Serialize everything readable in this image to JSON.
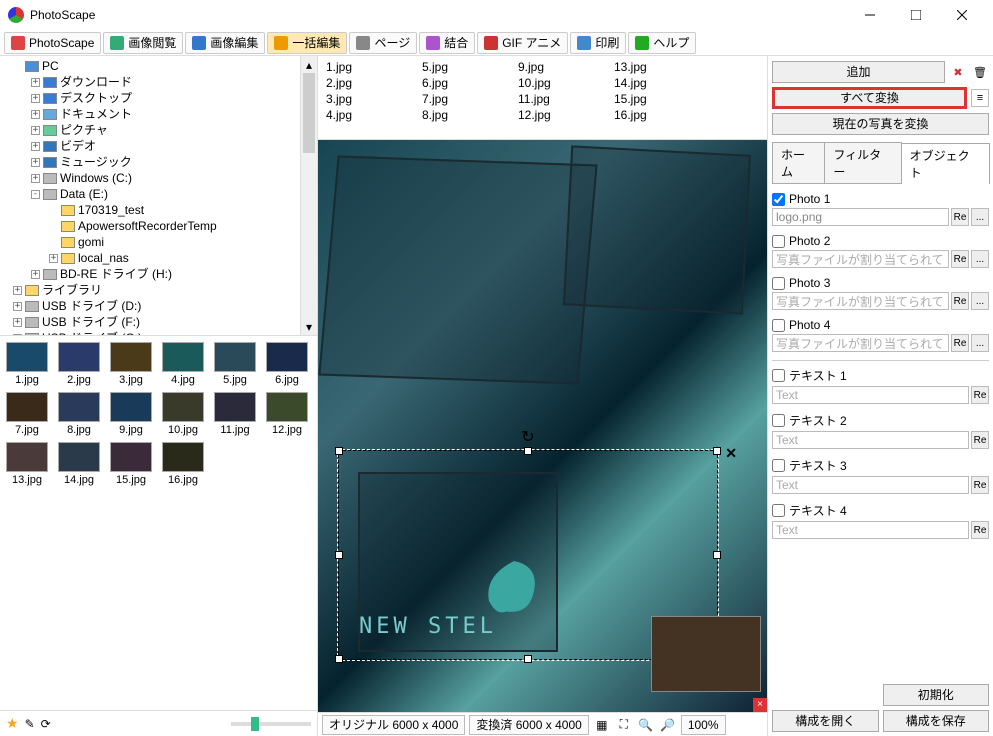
{
  "title": "PhotoScape",
  "toolbar": [
    {
      "label": "PhotoScape",
      "icon": "app"
    },
    {
      "label": "画像閲覧",
      "icon": "view"
    },
    {
      "label": "画像編集",
      "icon": "edit"
    },
    {
      "label": "一括編集",
      "icon": "batch",
      "active": true
    },
    {
      "label": "ページ",
      "icon": "page"
    },
    {
      "label": "結合",
      "icon": "combine"
    },
    {
      "label": "GIF アニメ",
      "icon": "gif"
    },
    {
      "label": "印刷",
      "icon": "print"
    },
    {
      "label": "ヘルプ",
      "icon": "help"
    }
  ],
  "tree": [
    {
      "depth": 0,
      "exp": "",
      "icon": "pc",
      "label": "PC"
    },
    {
      "depth": 1,
      "exp": "+",
      "icon": "dl",
      "label": "ダウンロード"
    },
    {
      "depth": 1,
      "exp": "+",
      "icon": "desk",
      "label": "デスクトップ"
    },
    {
      "depth": 1,
      "exp": "+",
      "icon": "doc",
      "label": "ドキュメント"
    },
    {
      "depth": 1,
      "exp": "+",
      "icon": "pic",
      "label": "ピクチャ"
    },
    {
      "depth": 1,
      "exp": "+",
      "icon": "vid",
      "label": "ビデオ"
    },
    {
      "depth": 1,
      "exp": "+",
      "icon": "mus",
      "label": "ミュージック"
    },
    {
      "depth": 1,
      "exp": "+",
      "icon": "hd",
      "label": "Windows (C:)"
    },
    {
      "depth": 1,
      "exp": "-",
      "icon": "hd",
      "label": "Data (E:)"
    },
    {
      "depth": 2,
      "exp": "",
      "icon": "folder",
      "label": "170319_test"
    },
    {
      "depth": 2,
      "exp": "",
      "icon": "folder",
      "label": "ApowersoftRecorderTemp"
    },
    {
      "depth": 2,
      "exp": "",
      "icon": "folder",
      "label": "gomi"
    },
    {
      "depth": 2,
      "exp": "+",
      "icon": "folder",
      "label": "local_nas"
    },
    {
      "depth": 1,
      "exp": "+",
      "icon": "hd",
      "label": "BD-RE ドライブ (H:)"
    },
    {
      "depth": 0,
      "exp": "+",
      "icon": "lib",
      "label": "ライブラリ"
    },
    {
      "depth": 0,
      "exp": "+",
      "icon": "hd",
      "label": "USB ドライブ (D:)"
    },
    {
      "depth": 0,
      "exp": "+",
      "icon": "hd",
      "label": "USB ドライブ (F:)"
    },
    {
      "depth": 0,
      "exp": "+",
      "icon": "hd",
      "label": "USB ドライブ (G:)"
    }
  ],
  "thumbs": [
    "1.jpg",
    "2.jpg",
    "3.jpg",
    "4.jpg",
    "5.jpg",
    "6.jpg",
    "7.jpg",
    "8.jpg",
    "9.jpg",
    "10.jpg",
    "11.jpg",
    "12.jpg",
    "13.jpg",
    "14.jpg",
    "15.jpg",
    "16.jpg"
  ],
  "fileGrid": [
    [
      "1.jpg",
      "2.jpg",
      "3.jpg",
      "4.jpg"
    ],
    [
      "5.jpg",
      "6.jpg",
      "7.jpg",
      "8.jpg"
    ],
    [
      "9.jpg",
      "10.jpg",
      "11.jpg",
      "12.jpg"
    ],
    [
      "13.jpg",
      "14.jpg",
      "15.jpg",
      "16.jpg"
    ]
  ],
  "overlayText": "NEW STEL",
  "status": {
    "original": "オリジナル 6000 x 4000",
    "converted": "変換済 6000 x 4000",
    "zoom": "100%"
  },
  "right": {
    "add": "追加",
    "convertAll": "すべて変換",
    "convertCurrent": "現在の写真を変換",
    "tabs": [
      "ホーム",
      "フィルター",
      "オブジェクト"
    ],
    "photos": [
      {
        "label": "Photo 1",
        "value": "logo.png",
        "checked": true
      },
      {
        "label": "Photo 2",
        "value": "写真ファイルが割り当てられていま",
        "checked": false
      },
      {
        "label": "Photo 3",
        "value": "写真ファイルが割り当てられていま",
        "checked": false
      },
      {
        "label": "Photo 4",
        "value": "写真ファイルが割り当てられていま",
        "checked": false
      }
    ],
    "texts": [
      {
        "label": "テキスト 1",
        "value": "Text"
      },
      {
        "label": "テキスト 2",
        "value": "Text"
      },
      {
        "label": "テキスト 3",
        "value": "Text"
      },
      {
        "label": "テキスト 4",
        "value": "Text"
      }
    ],
    "reset": "初期化",
    "openConfig": "構成を開く",
    "saveConfig": "構成を保存"
  }
}
